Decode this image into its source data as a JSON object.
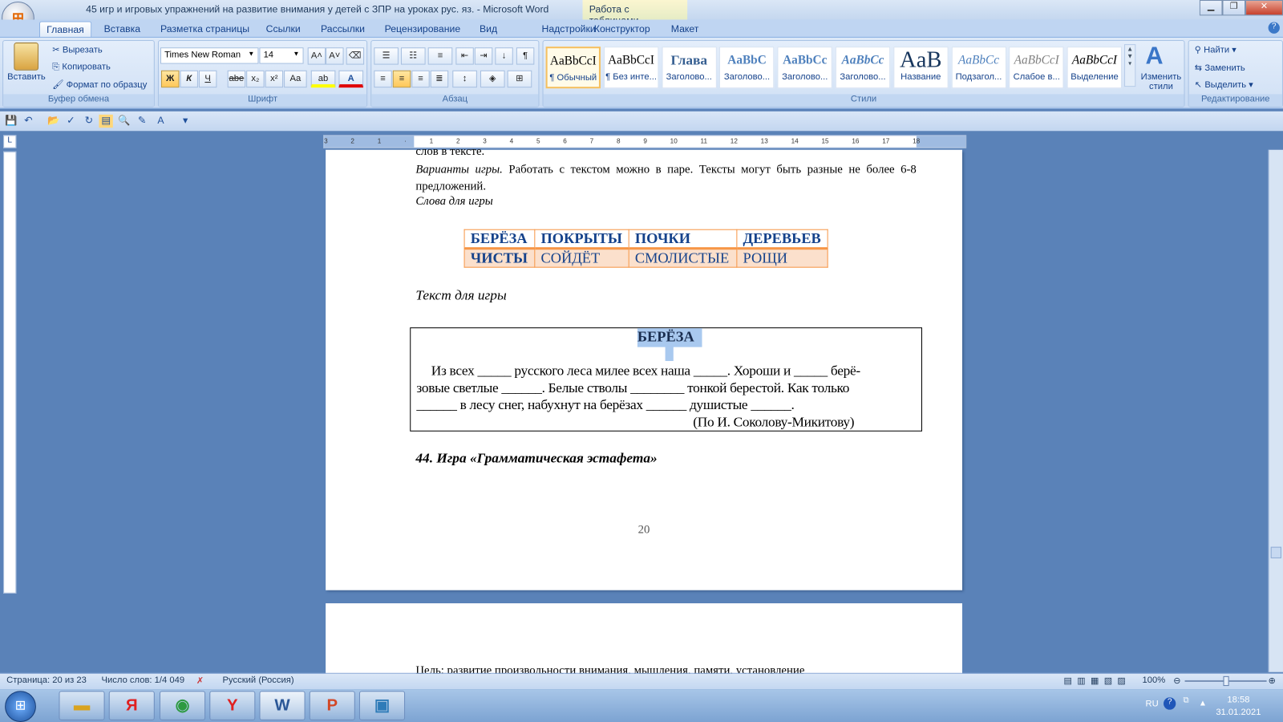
{
  "window": {
    "title": "45 игр и игровых упражнений на развитие внимания у детей с ЗПР на уроках рус. яз. - Microsoft Word",
    "context_tab_group": "Работа с таблицами",
    "minimize": "▁",
    "restore": "❐",
    "close": "✕"
  },
  "ribbon_tabs": [
    "Главная",
    "Вставка",
    "Разметка страницы",
    "Ссылки",
    "Рассылки",
    "Рецензирование",
    "Вид",
    "Надстройки",
    "Конструктор",
    "Макет"
  ],
  "clipboard": {
    "paste": "Вставить",
    "cut": "Вырезать",
    "copy": "Копировать",
    "format_painter": "Формат по образцу",
    "label": "Буфер обмена"
  },
  "font": {
    "name": "Times New Roman",
    "size": "14",
    "bold": "Ж",
    "italic": "К",
    "underline": "Ч",
    "strike": "abe",
    "sub": "x₂",
    "sup": "x²",
    "case": "Aa",
    "grow": "A˄",
    "shrink": "A˅",
    "label": "Шрифт"
  },
  "paragraph": {
    "label": "Абзац"
  },
  "styles": {
    "label": "Стили",
    "change": "Изменить стили",
    "items": [
      {
        "preview": "AaBbCcI",
        "name": "¶ Обычный",
        "color": "#000000"
      },
      {
        "preview": "AaBbCcI",
        "name": "¶ Без инте...",
        "color": "#000000"
      },
      {
        "preview": "Глава",
        "name": "Заголово...",
        "color": "#365f91"
      },
      {
        "preview": "AaBbC",
        "name": "Заголово...",
        "color": "#4f81bd"
      },
      {
        "preview": "AaBbCc",
        "name": "Заголово...",
        "color": "#4f81bd"
      },
      {
        "preview": "AaBbCc",
        "name": "Заголово...",
        "color": "#4f81bd"
      },
      {
        "preview": "AaB",
        "name": "Название",
        "color": "#17365d"
      },
      {
        "preview": "AaBbCc",
        "name": "Подзагол...",
        "color": "#4f81bd"
      },
      {
        "preview": "AaBbCcI",
        "name": "Слабое в...",
        "color": "#808080"
      },
      {
        "preview": "AaBbCcI",
        "name": "Выделение",
        "color": "#000000"
      }
    ]
  },
  "editing": {
    "find": "Найти",
    "replace": "Заменить",
    "select": "Выделить",
    "label": "Редактирование"
  },
  "document": {
    "line_cut": "слов в тексте.",
    "variants_label": "Варианты игры.",
    "variants_text": " Работать с текстом можно в паре. Тексты могут быть разные не более 6-8 предложений.",
    "words_label": "Слова для игры",
    "words_table": [
      [
        "БЕРЁЗА",
        "ПОКРЫТЫ",
        "ПОЧКИ",
        "ДЕРЕВЬЕВ"
      ],
      [
        "ЧИСТЫ",
        "СОЙДЁТ",
        "СМОЛИСТЫЕ",
        "РОЩИ"
      ]
    ],
    "text_label": "Текст для игры",
    "box_title": "БЕРЁЗА",
    "box_line1": "Из всех _____ русского леса милее всех наша _____. Хороши и _____ берё-",
    "box_line2": "зовые светлые ______. Белые стволы ________ тонкой берестой. Как только",
    "box_line3": "______ в лесу снег, набухнут на берёзах ______ душистые ______.",
    "box_author": "(По И. Соколову-Микитову)",
    "heading": "44. Игра «Грамматическая эстафета»",
    "page_number": "20",
    "next_page_text": "Цель: развитие произвольности внимания, мышления, памяти, установление"
  },
  "status": {
    "page": "Страница: 20 из 23",
    "words": "Число слов: 1/4 049",
    "language": "Русский (Россия)",
    "zoom": "100%",
    "zoom_level": 100
  },
  "taskbar": {
    "lang": "RU",
    "time": "18:58",
    "date": "31.01.2021"
  }
}
